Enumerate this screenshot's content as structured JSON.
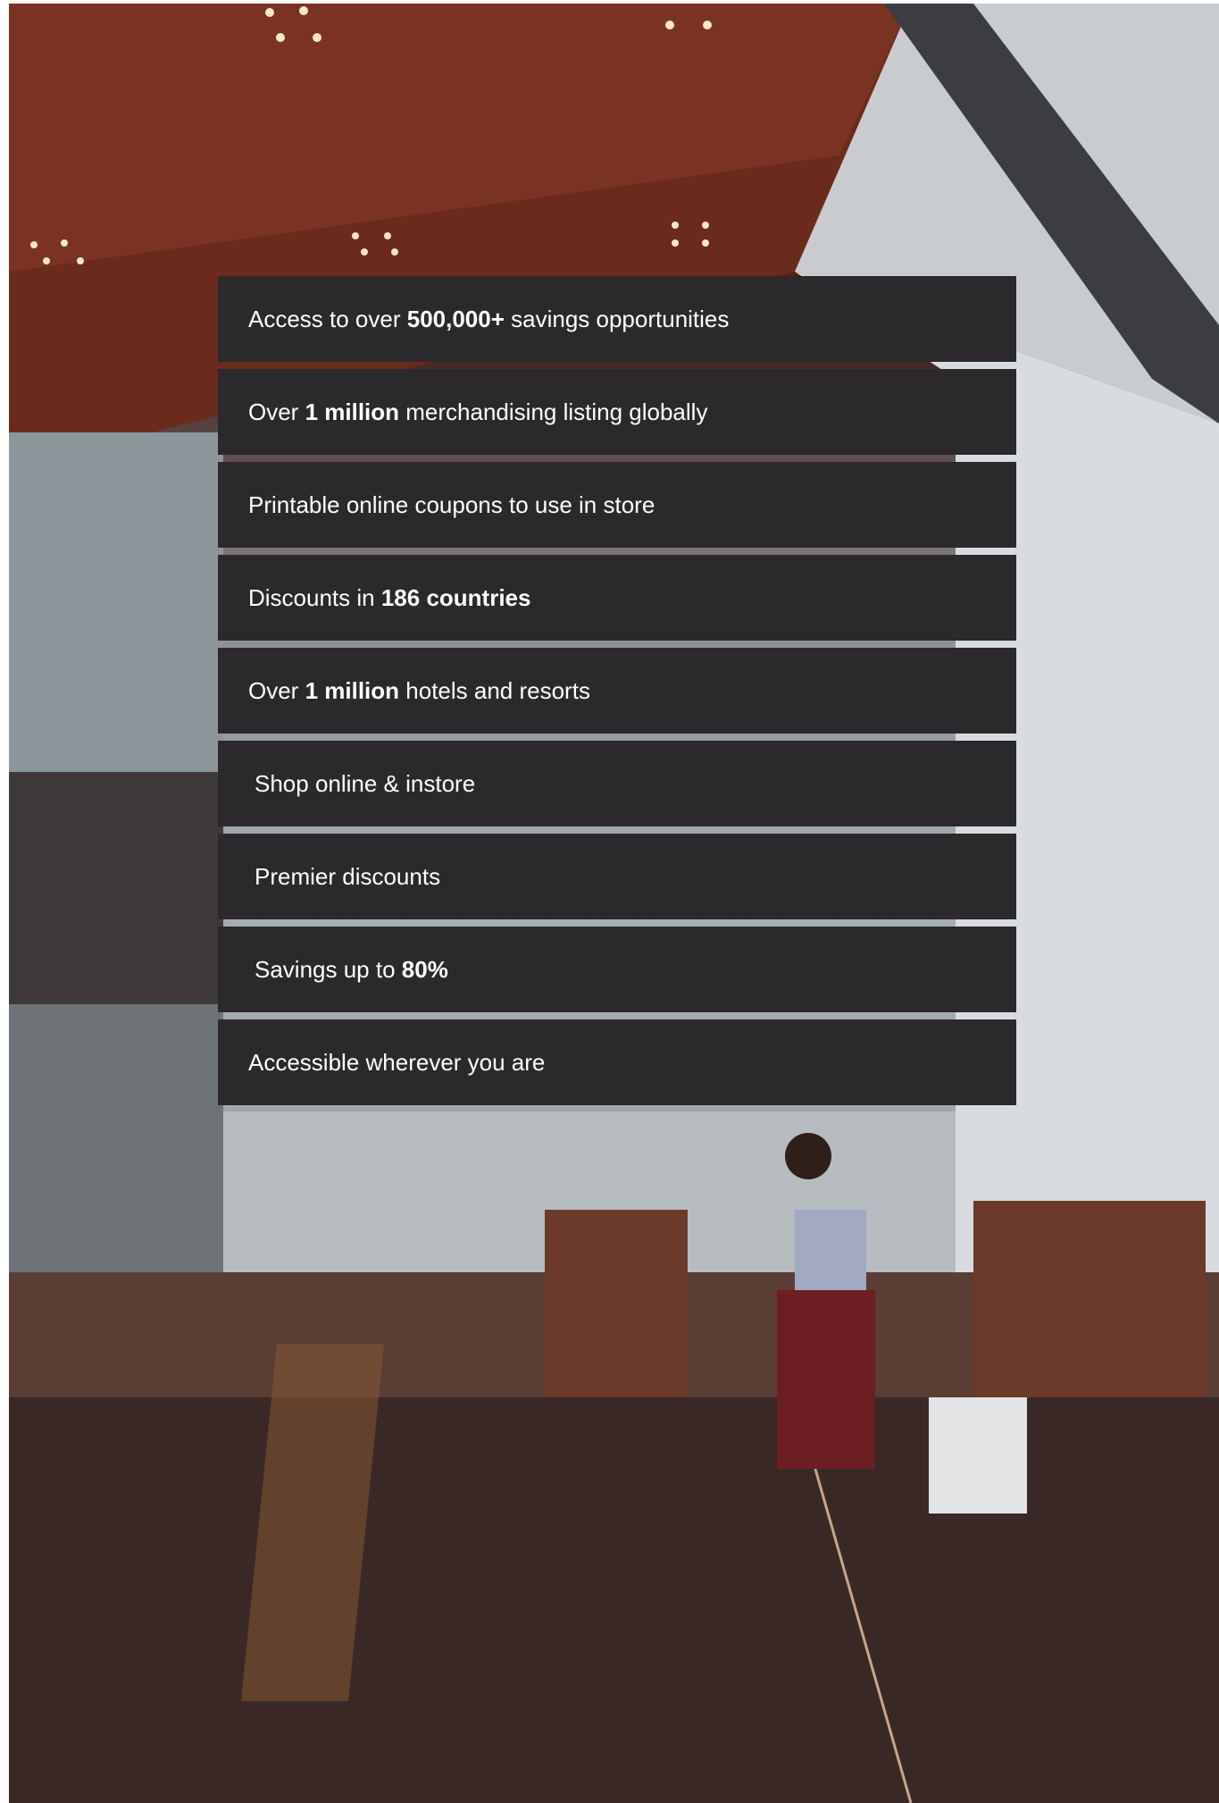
{
  "benefits": [
    {
      "before": "Access to over ",
      "bold": "500,000+",
      "after": " savings opportunities"
    },
    {
      "before": "Over ",
      "bold": "1 million",
      "after": " merchandising listing globally"
    },
    {
      "before": "Printable online coupons to use in store",
      "bold": "",
      "after": ""
    },
    {
      "before": "Discounts in ",
      "bold": "186 countries",
      "after": ""
    },
    {
      "before": "Over ",
      "bold": "1 million",
      "after": " hotels and resorts"
    },
    {
      "before": "Shop online & instore",
      "bold": "",
      "after": ""
    },
    {
      "before": "Premier discounts",
      "bold": "",
      "after": ""
    },
    {
      "before": "Savings up to ",
      "bold": "80%",
      "after": ""
    },
    {
      "before": "Accessible wherever you are",
      "bold": "",
      "after": ""
    }
  ]
}
